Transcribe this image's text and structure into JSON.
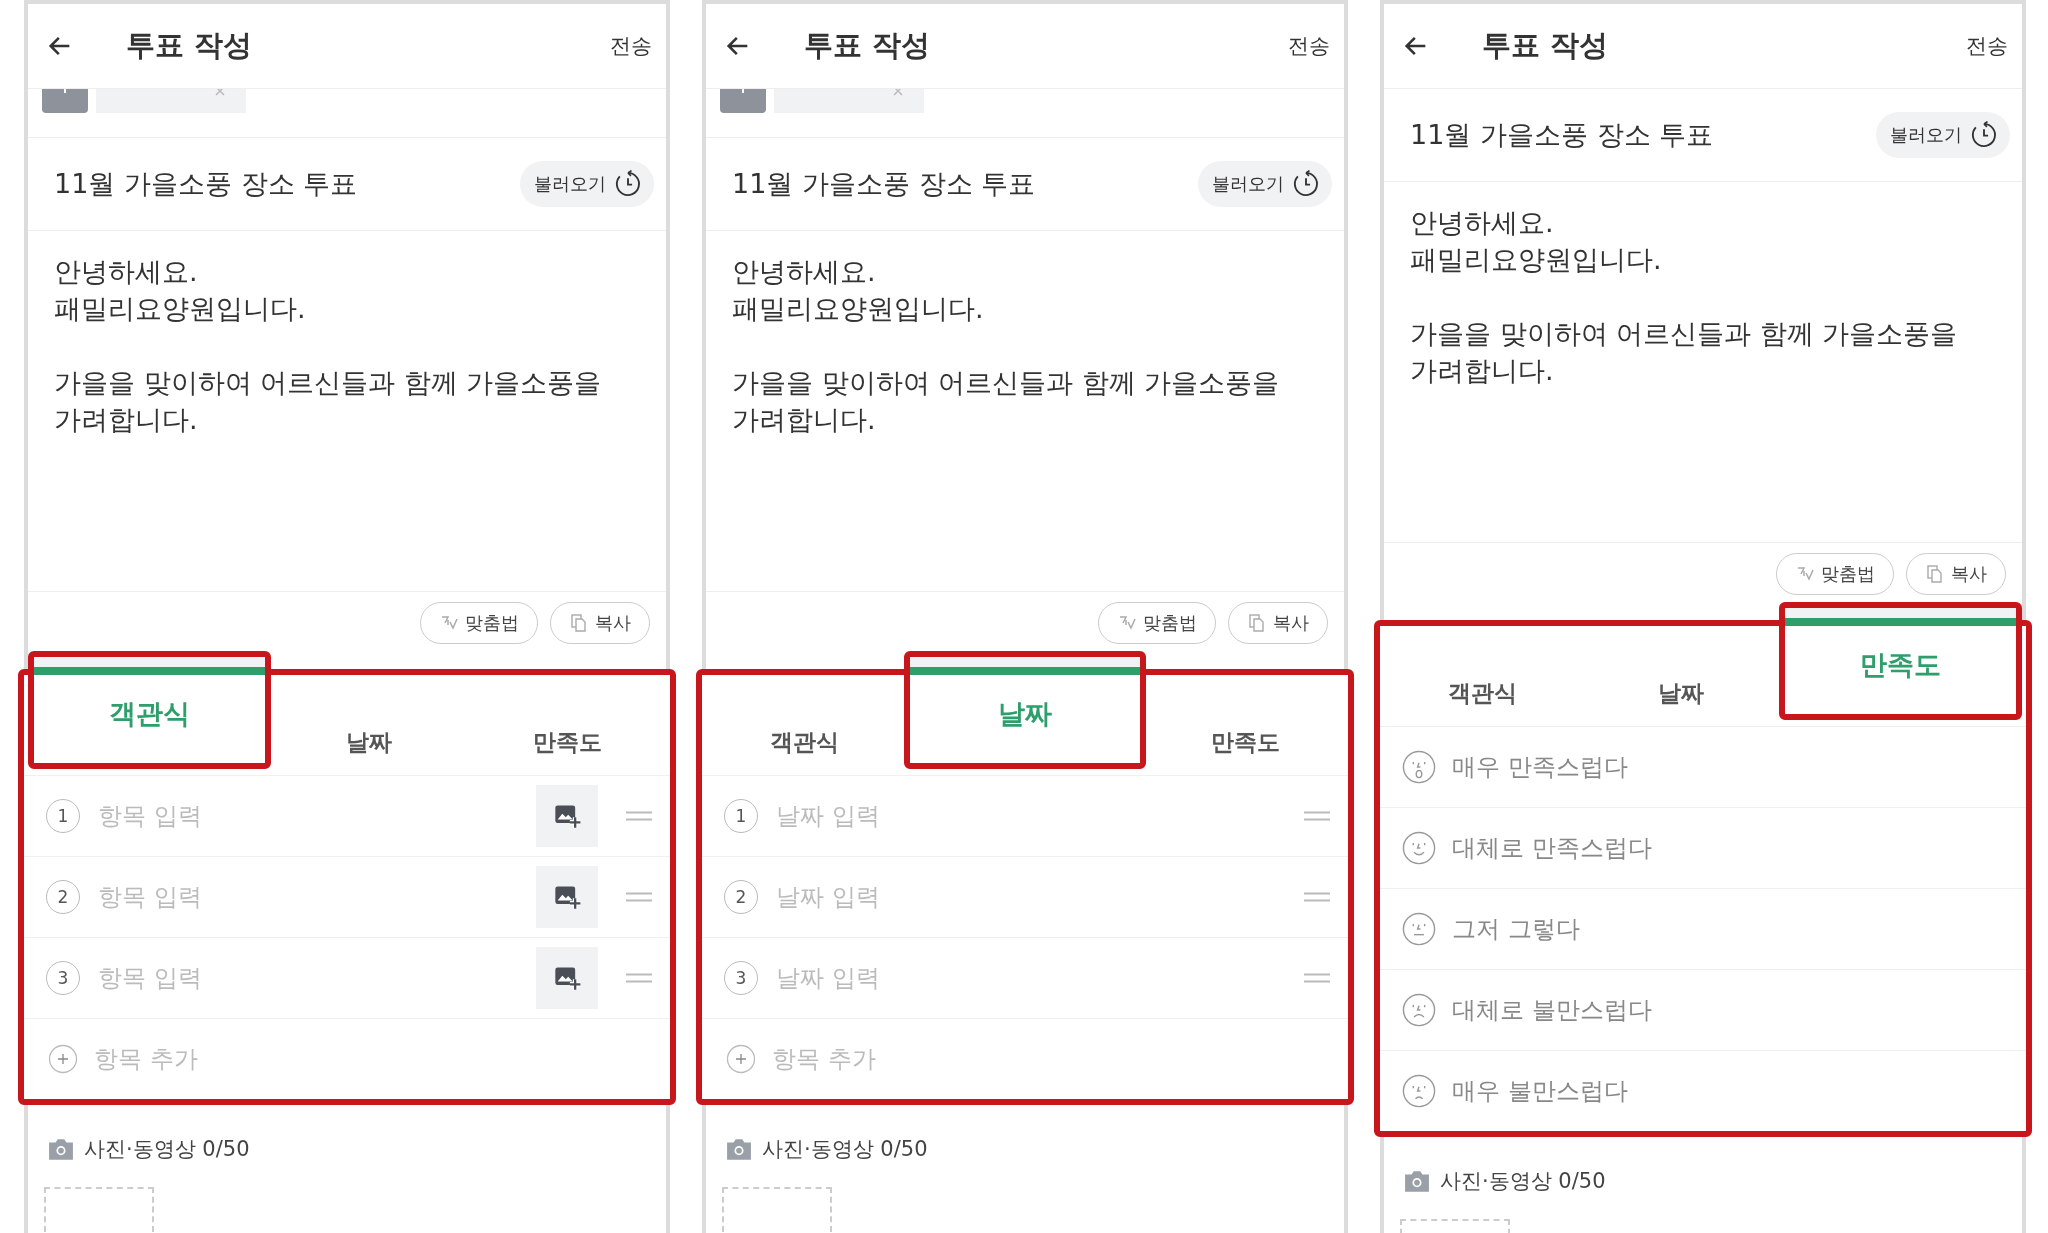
{
  "panels": [
    {
      "header": {
        "title": "투표 작성",
        "send": "전송"
      },
      "tag_row": true,
      "poll_title": "11월 가을소풍 장소 투표",
      "load_button": "불러오기",
      "body": [
        "안녕하세요.\n패밀리요양원입니다.",
        "가을을 맞이하여 어르신들과 함께 가을소풍을 가려합니다."
      ],
      "tools": [
        "맞춤법",
        "복사"
      ],
      "tabs": [
        {
          "label": "객관식",
          "selected": true
        },
        {
          "label": "날짜",
          "selected": false
        },
        {
          "label": "만족도",
          "selected": false
        }
      ],
      "items": [
        {
          "kind": "option",
          "number": "1",
          "placeholder": "항목 입력"
        },
        {
          "kind": "option",
          "number": "2",
          "placeholder": "항목 입력"
        },
        {
          "kind": "option",
          "number": "3",
          "placeholder": "항목 입력"
        },
        {
          "kind": "add",
          "label": "항목 추가"
        }
      ],
      "media": {
        "label": "사진·동영상 0/50"
      }
    },
    {
      "header": {
        "title": "투표 작성",
        "send": "전송"
      },
      "tag_row": true,
      "poll_title": "11월 가을소풍 장소 투표",
      "load_button": "불러오기",
      "body": [
        "안녕하세요.\n패밀리요양원입니다.",
        "가을을 맞이하여 어르신들과 함께 가을소풍을 가려합니다."
      ],
      "tools": [
        "맞춤법",
        "복사"
      ],
      "tabs": [
        {
          "label": "객관식",
          "selected": false
        },
        {
          "label": "날짜",
          "selected": true
        },
        {
          "label": "만족도",
          "selected": false
        }
      ],
      "items": [
        {
          "kind": "date",
          "number": "1",
          "placeholder": "날짜 입력"
        },
        {
          "kind": "date",
          "number": "2",
          "placeholder": "날짜 입력"
        },
        {
          "kind": "date",
          "number": "3",
          "placeholder": "날짜 입력"
        },
        {
          "kind": "add",
          "label": "항목 추가"
        }
      ],
      "media": {
        "label": "사진·동영상 0/50"
      }
    },
    {
      "header": {
        "title": "투표 작성",
        "send": "전송"
      },
      "poll_title": "11월 가을소풍 장소 투표",
      "load_button": "불러오기",
      "body": [
        "안녕하세요.\n패밀리요양원입니다.",
        "가을을 맞이하여 어르신들과 함께 가을소풍을 가려합니다."
      ],
      "tools": [
        "맞춤법",
        "복사"
      ],
      "tabs": [
        {
          "label": "객관식",
          "selected": false
        },
        {
          "label": "날짜",
          "selected": false
        },
        {
          "label": "만족도",
          "selected": true
        }
      ],
      "items": [
        {
          "kind": "delighted",
          "label": "매우 만족스럽다"
        },
        {
          "kind": "pleased",
          "label": "대체로 만족스럽다"
        },
        {
          "kind": "neutral",
          "label": "그저 그렇다"
        },
        {
          "kind": "displeased",
          "label": "대체로 불만스럽다"
        },
        {
          "kind": "upset",
          "label": "매우 불만스럽다"
        }
      ],
      "media": {
        "label": "사진·동영상 0/50"
      }
    }
  ]
}
